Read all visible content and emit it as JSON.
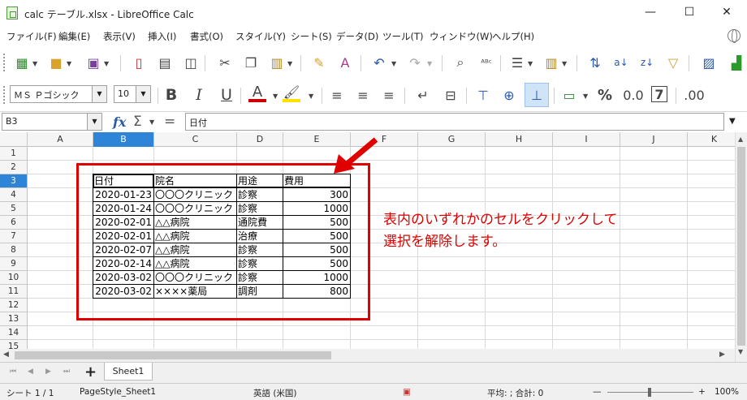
{
  "window": {
    "title": "calc テーブル.xlsx - LibreOffice Calc",
    "minimize": "—",
    "maximize": "☐",
    "close": "✕"
  },
  "menu": [
    "ファイル(F)",
    "編集(E)",
    "表示(V)",
    "挿入(I)",
    "書式(O)",
    "スタイル(Y)",
    "シート(S)",
    "データ(D)",
    "ツール(T)",
    "ウィンドウ(W)",
    "ヘルプ(H)"
  ],
  "format": {
    "font_name": "ＭＳ Ｐゴシック",
    "font_size": "10",
    "bold": "B",
    "italic": "I",
    "underline": "U",
    "percent": "%",
    "number_format": "0.0",
    "decimal_add": ".00"
  },
  "formula_bar": {
    "name_box": "B3",
    "formula": "日付",
    "fx": "fx",
    "sum": "Σ",
    "equals": "="
  },
  "columns": [
    "A",
    "B",
    "C",
    "D",
    "E",
    "F",
    "G",
    "H",
    "I",
    "J",
    "K"
  ],
  "selected_column": "B",
  "rows": [
    "1",
    "2",
    "3",
    "4",
    "5",
    "6",
    "7",
    "8",
    "9",
    "10",
    "11",
    "12",
    "13",
    "14",
    "15"
  ],
  "selected_row": "3",
  "table": {
    "headers": [
      "日付",
      "院名",
      "用途",
      "費用"
    ],
    "records": [
      [
        "2020-01-23",
        "〇〇〇クリニック",
        "診察",
        "300"
      ],
      [
        "2020-01-24",
        "〇〇〇クリニック",
        "診察",
        "1000"
      ],
      [
        "2020-02-01",
        "△△病院",
        "通院費",
        "500"
      ],
      [
        "2020-02-01",
        "△△病院",
        "治療",
        "500"
      ],
      [
        "2020-02-07",
        "△△病院",
        "診察",
        "500"
      ],
      [
        "2020-02-14",
        "△△病院",
        "診察",
        "500"
      ],
      [
        "2020-03-02",
        "〇〇〇クリニック",
        "診察",
        "1000"
      ],
      [
        "2020-03-02",
        "××××薬局",
        "調剤",
        "800"
      ]
    ]
  },
  "annotation": {
    "line1": "表内のいずれかのセルをクリックして",
    "line2": "選択を解除します。",
    "color": "#e00000"
  },
  "sheet_tabs": {
    "add": "+",
    "active": "Sheet1"
  },
  "status": {
    "sheet": "シート 1 / 1",
    "page_style": "PageStyle_Sheet1",
    "language": "英語 (米国)",
    "summary": "平均: ; 合計: 0",
    "zoom": "100%"
  },
  "colors": {
    "selection": "#2e84d6",
    "accent_red": "#e00000"
  }
}
